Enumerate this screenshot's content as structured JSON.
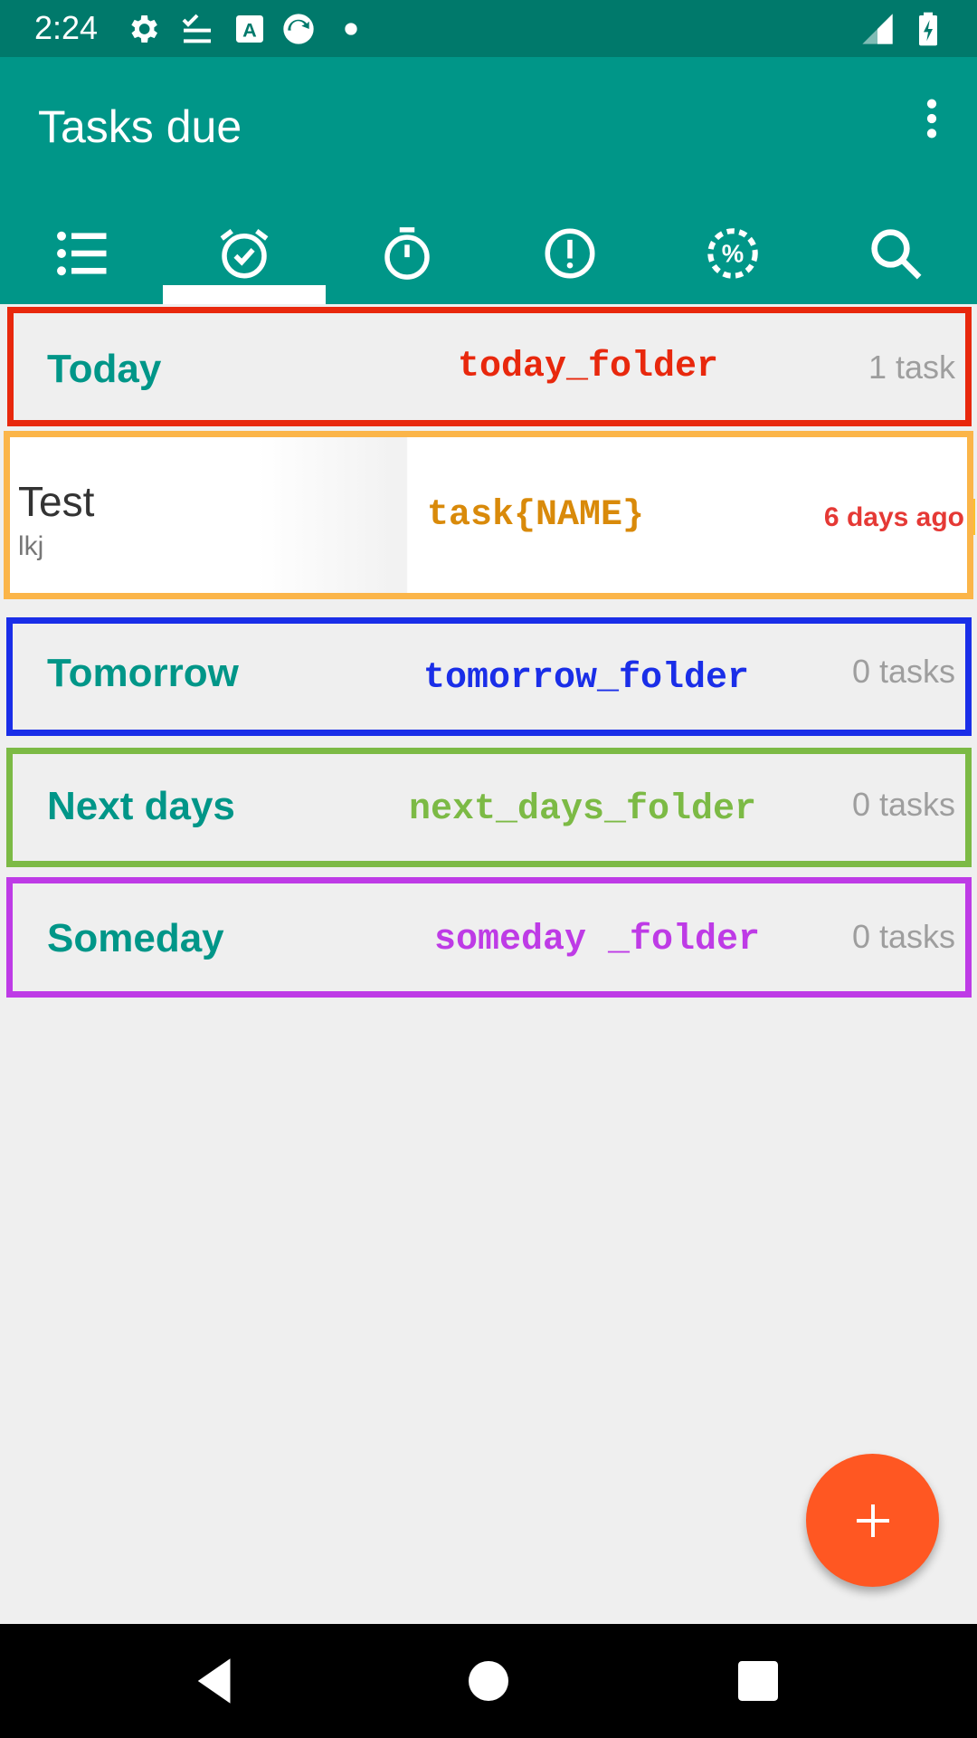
{
  "status_bar": {
    "time": "2:24",
    "left_icons": [
      "gear-icon",
      "download-check-icon",
      "accessibility-a-icon",
      "sync-circle-icon",
      "dot-icon"
    ],
    "right_icons": [
      "signal-icon",
      "battery-charging-icon"
    ]
  },
  "app_bar": {
    "title": "Tasks due",
    "menu_icon": "more-vert-icon",
    "color": "#009688"
  },
  "tabs": [
    {
      "icon": "list-icon",
      "selected": false
    },
    {
      "icon": "alarm-check-icon",
      "selected": true
    },
    {
      "icon": "stopwatch-icon",
      "selected": false
    },
    {
      "icon": "priority-exclamation-icon",
      "selected": false
    },
    {
      "icon": "percent-progress-icon",
      "selected": false
    },
    {
      "icon": "search-icon",
      "selected": false
    }
  ],
  "folders": [
    {
      "title": "Today",
      "count": "1 task",
      "overlay": "today_folder",
      "overlay_color": "#e8280d"
    },
    {
      "title": "Tomorrow",
      "count": "0 tasks",
      "overlay": "tomorrow_folder",
      "overlay_color": "#1a2ee8"
    },
    {
      "title": "Next days",
      "count": "0 tasks",
      "overlay": "next_days_folder",
      "overlay_color": "#7cba45"
    },
    {
      "title": "Someday",
      "count": "0 tasks",
      "overlay": "someday _folder",
      "overlay_color": "#be3be6"
    }
  ],
  "task": {
    "name": "Test",
    "description": "lkj",
    "due": "6 days ago",
    "overlay": "task{NAME}",
    "overlay_color": "#d98a0a",
    "box_color": "#fbb549"
  },
  "fab": {
    "icon": "plus-icon",
    "color": "#ff5722"
  },
  "nav_bar": {
    "icons": [
      "back-icon",
      "home-icon",
      "recents-icon"
    ]
  }
}
